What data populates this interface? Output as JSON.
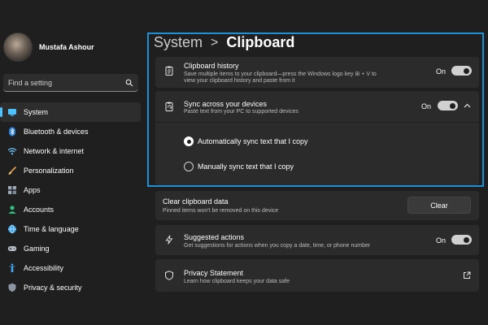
{
  "profile": {
    "name": "Mustafa Ashour"
  },
  "search": {
    "placeholder": "Find a setting"
  },
  "nav": [
    {
      "label": "System",
      "icon": "system-icon"
    },
    {
      "label": "Bluetooth & devices",
      "icon": "bluetooth-icon"
    },
    {
      "label": "Network & internet",
      "icon": "wifi-icon"
    },
    {
      "label": "Personalization",
      "icon": "brush-icon"
    },
    {
      "label": "Apps",
      "icon": "apps-icon"
    },
    {
      "label": "Accounts",
      "icon": "accounts-icon"
    },
    {
      "label": "Time & language",
      "icon": "globe-icon"
    },
    {
      "label": "Gaming",
      "icon": "gamepad-icon"
    },
    {
      "label": "Accessibility",
      "icon": "accessibility-icon"
    },
    {
      "label": "Privacy & security",
      "icon": "shield-icon"
    }
  ],
  "breadcrumb": {
    "parent": "System",
    "separator": ">",
    "current": "Clipboard"
  },
  "clipboard_history": {
    "title": "Clipboard history",
    "desc_line1": "Save multiple items to your clipboard—press the Windows logo key ⊞ + V to",
    "desc_line2": "view your clipboard history and paste from it",
    "toggle_label": "On"
  },
  "sync": {
    "title": "Sync across your devices",
    "desc": "Paste text from your PC to supported devices",
    "toggle_label": "On",
    "options": [
      {
        "label": "Automatically sync text that I copy",
        "checked": true
      },
      {
        "label": "Manually sync text that I copy",
        "checked": false
      }
    ]
  },
  "clear_data": {
    "title": "Clear clipboard data",
    "desc": "Pinned items won't be removed on this device",
    "button_label": "Clear"
  },
  "suggested": {
    "title": "Suggested actions",
    "desc": "Get suggestions for actions when you copy a date, time, or phone number",
    "toggle_label": "On"
  },
  "privacy": {
    "title": "Privacy Statement",
    "desc": "Learn how clipboard keeps your data safe"
  },
  "colors": {
    "accent": "#4cc2ff",
    "highlight_border": "#1e90d6",
    "background": "#1f1f1f",
    "card": "#2b2b2b"
  }
}
